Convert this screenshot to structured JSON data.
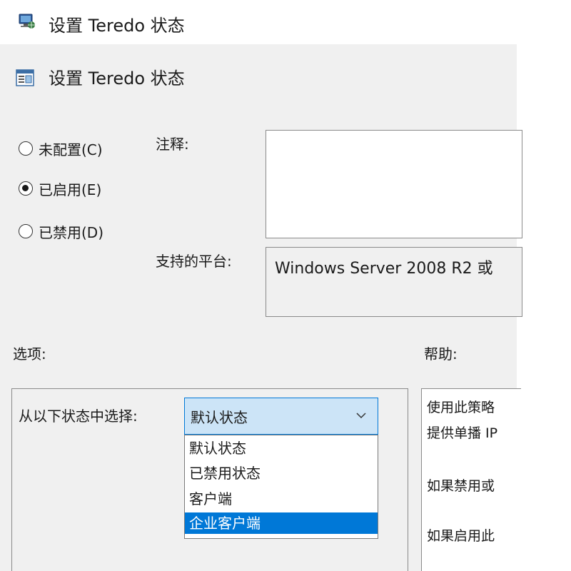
{
  "window": {
    "title": "设置 Teredo 状态"
  },
  "header": {
    "title": "设置 Teredo 状态"
  },
  "state": {
    "options": [
      {
        "label": "未配置(C)",
        "checked": false
      },
      {
        "label": "已启用(E)",
        "checked": true
      },
      {
        "label": "已禁用(D)",
        "checked": false
      }
    ]
  },
  "comment": {
    "label": "注释:",
    "value": ""
  },
  "platform": {
    "label": "支持的平台:",
    "value": "Windows Server 2008 R2 或"
  },
  "options_section": {
    "label": "选项:",
    "select_label": "从以下状态中选择:",
    "selected_value": "默认状态",
    "dropdown": [
      "默认状态",
      "已禁用状态",
      "客户端",
      "企业客户端"
    ],
    "highlighted_index": 3
  },
  "help": {
    "label": "帮助:",
    "lines": [
      "使用此策略",
      "提供单播 IP",
      "如果禁用或",
      "如果启用此"
    ]
  },
  "colors": {
    "accent": "#0078d7",
    "select_bg": "#cce4f7",
    "panel_bg": "#f0f0f0"
  }
}
